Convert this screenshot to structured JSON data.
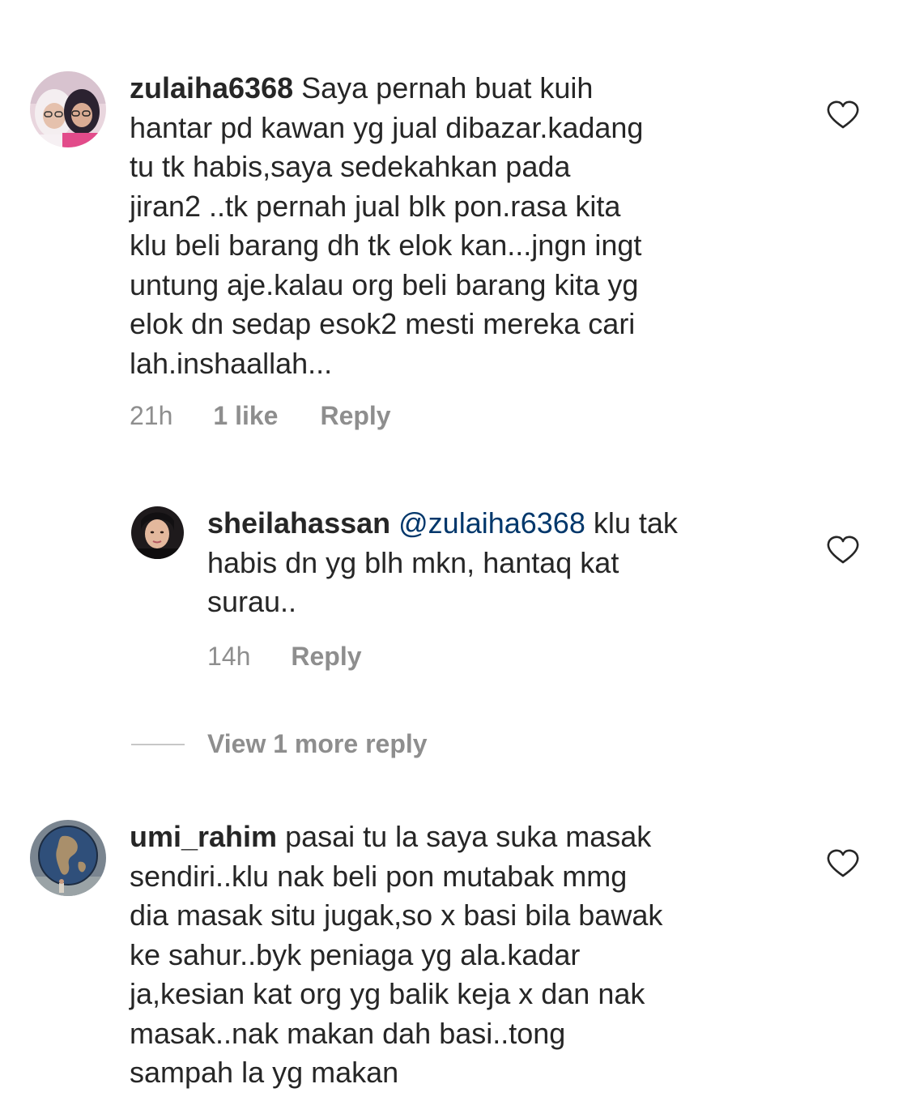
{
  "comments": [
    {
      "username": "zulaiha6368",
      "mention": "",
      "lines": [
        " Saya pernah buat kuih",
        "hantar pd kawan yg jual dibazar.kadang",
        "tu tk habis,saya sedekahkan pada",
        "jiran2 ..tk pernah jual blk pon.rasa kita",
        "klu beli barang dh tk elok kan...jngn ingt",
        "untung aje.kalau org beli barang kita yg",
        "elok dn sedap esok2 mesti mereka cari",
        "lah.inshaallah..."
      ],
      "time": "21h",
      "likes": "1 like",
      "reply_label": "Reply",
      "avatar_icon": "profile-photo-two-women",
      "like_icon": "heart-outline-icon"
    },
    {
      "username": "sheilahassan",
      "mention": "@zulaiha6368",
      "lines": [
        " klu tak",
        "habis dn yg blh mkn, hantaq kat",
        "surau.."
      ],
      "time": "14h",
      "likes": "",
      "reply_label": "Reply",
      "avatar_icon": "profile-photo-woman-hijab",
      "like_icon": "heart-outline-icon"
    },
    {
      "username": "umi_rahim",
      "mention": "",
      "lines": [
        " pasai tu la saya suka masak",
        "sendiri..klu nak beli pon mutabak mmg",
        "dia masak situ jugak,so x basi bila bawak",
        "ke sahur..byk peniaga yg ala.kadar",
        "ja,kesian kat org yg balik keja x dan nak",
        "masak..nak makan dah basi..tong",
        "sampah la yg makan"
      ],
      "time": "",
      "likes": "",
      "reply_label": "",
      "avatar_icon": "profile-photo-globe",
      "like_icon": "heart-outline-icon"
    }
  ],
  "view_more": {
    "label": "View 1 more reply"
  },
  "colors": {
    "text": "#262626",
    "muted": "#8e8e8e",
    "mention": "#00376b",
    "divider": "#c7c7c7"
  }
}
